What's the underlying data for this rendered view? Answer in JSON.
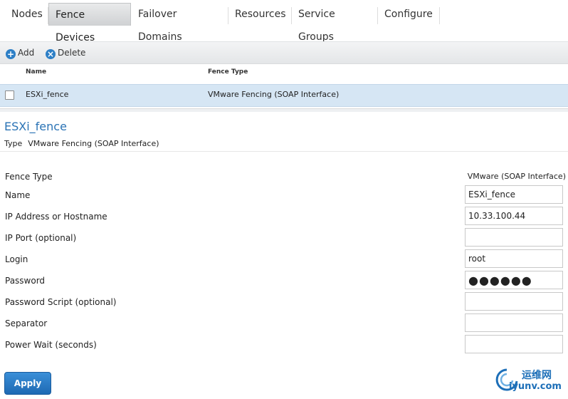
{
  "tabs": [
    {
      "label": "Nodes"
    },
    {
      "label": "Fence Devices",
      "active": true
    },
    {
      "label": "Failover Domains"
    },
    {
      "label": "Resources"
    },
    {
      "label": "Service Groups"
    },
    {
      "label": "Configure"
    }
  ],
  "toolbar": {
    "add_label": "Add",
    "delete_label": "Delete"
  },
  "grid": {
    "columns": [
      "Name",
      "Fence Type"
    ],
    "rows": [
      {
        "name": "ESXi_fence",
        "fence_type": "VMware Fencing (SOAP Interface)",
        "checked": false
      }
    ]
  },
  "detail": {
    "title": "ESXi_fence",
    "type_label": "Type",
    "type_value": "VMware Fencing (SOAP Interface)",
    "fields": [
      {
        "label": "Fence Type",
        "value": "VMware (SOAP Interface)",
        "kind": "text"
      },
      {
        "label": "Name",
        "value": "ESXi_fence",
        "kind": "input"
      },
      {
        "label": "IP Address or Hostname",
        "value": "10.33.100.44",
        "kind": "input"
      },
      {
        "label": "IP Port (optional)",
        "value": "",
        "kind": "input"
      },
      {
        "label": "Login",
        "value": "root",
        "kind": "input"
      },
      {
        "label": "Password",
        "value": "●●●●●●",
        "kind": "password"
      },
      {
        "label": "Password Script (optional)",
        "value": "",
        "kind": "input"
      },
      {
        "label": "Separator",
        "value": "",
        "kind": "input"
      },
      {
        "label": "Power Wait (seconds)",
        "value": "",
        "kind": "input"
      }
    ],
    "apply_label": "Apply"
  },
  "watermark": {
    "line1": "运维网",
    "line2": "iyunv.com"
  },
  "colors": {
    "accent": "#2a73b5",
    "row_selected": "#d6e6f4",
    "button": "#1e69b3"
  }
}
